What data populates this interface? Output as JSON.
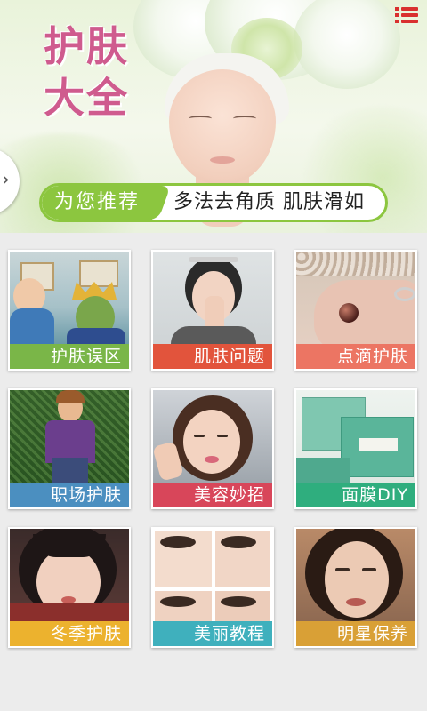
{
  "app": {
    "title_line1": "护肤",
    "title_line2": "大全"
  },
  "recommend": {
    "tag": "为您推荐",
    "text": "多法去角质 肌肤滑如"
  },
  "icons": {
    "menu": "menu-list-icon",
    "side": "chevron-right-icon"
  },
  "tiles": [
    {
      "label": "护肤误区",
      "color": "#7ab648"
    },
    {
      "label": "肌肤问题",
      "color": "#e2543c"
    },
    {
      "label": "点滴护肤",
      "color": "#ec7563"
    },
    {
      "label": "职场护肤",
      "color": "#4b8fc0"
    },
    {
      "label": "美容妙招",
      "color": "#d8465a"
    },
    {
      "label": "面膜DIY",
      "color": "#2fae7e"
    },
    {
      "label": "冬季护肤",
      "color": "#ecb22e"
    },
    {
      "label": "美丽教程",
      "color": "#3fb0bd"
    },
    {
      "label": "明星保养",
      "color": "#d9a036"
    }
  ]
}
